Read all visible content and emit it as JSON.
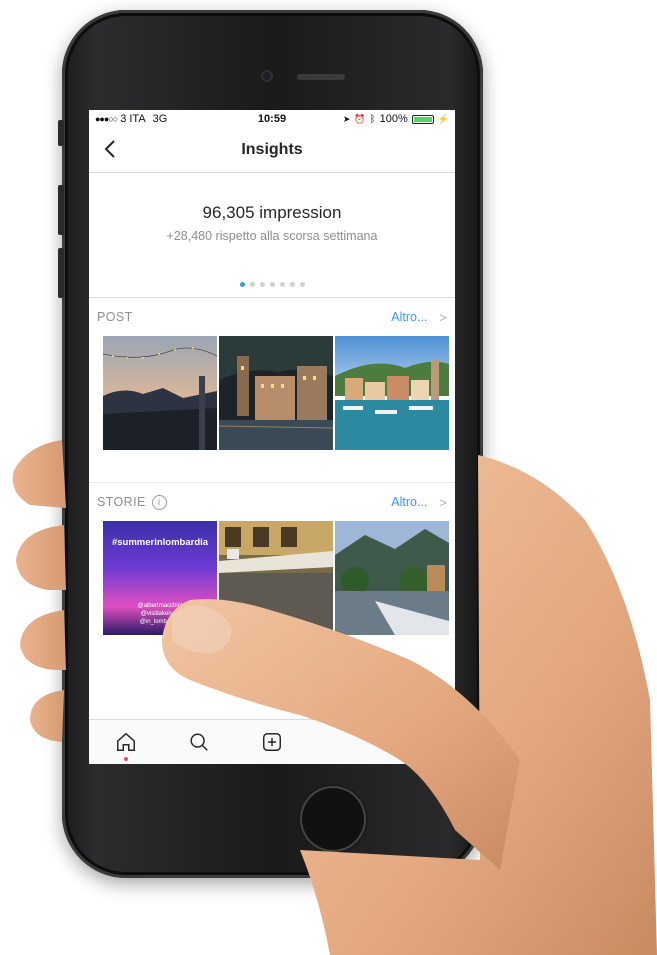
{
  "status_bar": {
    "carrier": "3 ITA",
    "network": "3G",
    "time": "10:59",
    "battery": "100%"
  },
  "header": {
    "title": "Insights",
    "back_icon": "chevron-left-icon"
  },
  "stats": {
    "impressions": "96,305 impression",
    "change": "+28,480 rispetto alla scorsa settimana",
    "page_count": 7,
    "active_page": 1
  },
  "posts": {
    "label": "POST",
    "more_label": "Altro...",
    "more_chevron": ">"
  },
  "stories": {
    "label": "STORIE",
    "info_icon": "i",
    "more_label": "Altro...",
    "more_chevron": ">",
    "hashtag": "#summerinlombardia",
    "credits": [
      "@albertmacchini",
      "@visitlakeiseo",
      "@in_lombardia"
    ]
  },
  "tab_bar": {
    "items": [
      "home-icon",
      "search-icon",
      "add-icon"
    ]
  },
  "colors": {
    "accent": "#3897f0",
    "notification": "#ed4956",
    "battery": "#4cd964"
  }
}
